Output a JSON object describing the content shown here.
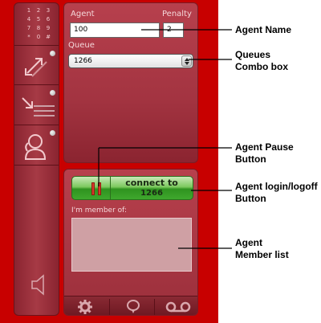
{
  "colors": {
    "background_red": "#c80000",
    "panel_red": "#a33441",
    "connect_green": "#3fa82d",
    "pause_red": "#d83a2a",
    "annotation_line": "#000000"
  },
  "left_toolbar": {
    "buttons": [
      {
        "icon": "dialpad-icon",
        "digits": [
          "1",
          "2",
          "3",
          "4",
          "5",
          "6",
          "7",
          "8",
          "9",
          "*",
          "0",
          "#"
        ]
      },
      {
        "icon": "transfer-arrows-icon"
      },
      {
        "icon": "forward-list-icon"
      },
      {
        "icon": "agent-headset-icon"
      },
      {
        "icon": "speaker-icon"
      }
    ]
  },
  "agent_panel": {
    "agent_label": "Agent",
    "penalty_label": "Penalty",
    "agent_value": "100",
    "penalty_value": "2",
    "queue_label": "Queue",
    "queue_selected": "1266"
  },
  "login_panel": {
    "connect_line1": "connect to",
    "connect_line2": "1266",
    "member_label": "I'm member of:",
    "member_items": []
  },
  "bottom_bar": {
    "icons": [
      "gear-icon",
      "chat-bubble-icon",
      "voicemail-icon"
    ]
  },
  "annotations": {
    "agent_name": [
      "Agent Name"
    ],
    "queues_combo": [
      "Queues",
      "Combo box"
    ],
    "agent_pause": [
      "Agent Pause",
      "Button"
    ],
    "agent_login": [
      "Agent login/logoff",
      "Button"
    ],
    "agent_member": [
      "Agent",
      "Member list"
    ]
  }
}
